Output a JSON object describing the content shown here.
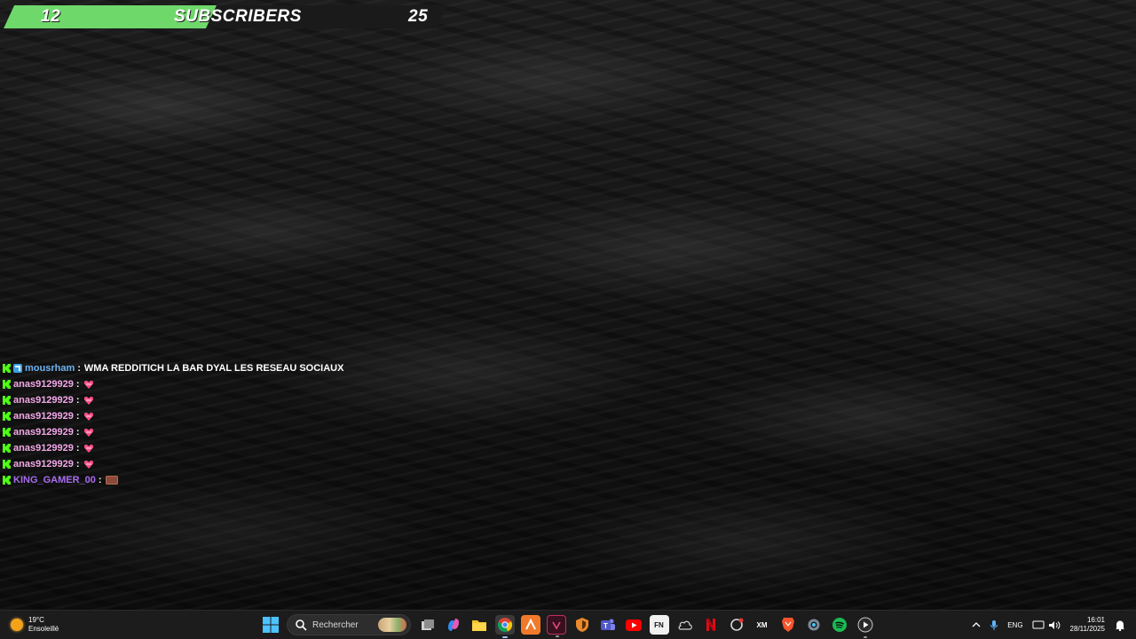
{
  "goal": {
    "current": "12",
    "label": "SUBSCRIBERS",
    "target": "25",
    "progress_fraction": 0.48,
    "fill_color": "#6fd86b"
  },
  "chat": {
    "messages": [
      {
        "user": "mousrham",
        "user_color": "#6fb3f2",
        "badge": "verified-badge-icon",
        "text": "WMA REDDITICH LA BAR DYAL LES RESEAU SOCIAUX",
        "emote": null
      },
      {
        "user": "anas9129929",
        "user_color": "#f4a8e8",
        "badge": null,
        "text": "",
        "emote": "heart-emote-icon"
      },
      {
        "user": "anas9129929",
        "user_color": "#f4a8e8",
        "badge": null,
        "text": "",
        "emote": "heart-emote-icon"
      },
      {
        "user": "anas9129929",
        "user_color": "#f4a8e8",
        "badge": null,
        "text": "",
        "emote": "heart-emote-icon"
      },
      {
        "user": "anas9129929",
        "user_color": "#f4a8e8",
        "badge": null,
        "text": "",
        "emote": "heart-emote-icon"
      },
      {
        "user": "anas9129929",
        "user_color": "#f4a8e8",
        "badge": null,
        "text": "",
        "emote": "heart-emote-icon"
      },
      {
        "user": "anas9129929",
        "user_color": "#f4a8e8",
        "badge": null,
        "text": "",
        "emote": "heart-emote-icon"
      },
      {
        "user": "KING_GAMER_00",
        "user_color": "#a86cf0",
        "badge": null,
        "text": "",
        "emote": "image-emote-icon"
      }
    ],
    "separator": ":",
    "platform_icon": "kick-icon",
    "platform_color": "#53fc18"
  },
  "taskbar": {
    "weather": {
      "temp": "19°C",
      "condition": "Ensoleillé",
      "icon": "sun-icon"
    },
    "search_placeholder": "Rechercher",
    "pinned": [
      {
        "name": "start-button",
        "icon": "windows-icon"
      },
      {
        "name": "search"
      },
      {
        "name": "task-view-button",
        "icon": "task-view-icon"
      },
      {
        "name": "copilot-button",
        "icon": "copilot-icon"
      },
      {
        "name": "file-explorer-button",
        "icon": "folder-icon"
      },
      {
        "name": "chrome-button",
        "icon": "chrome-icon"
      },
      {
        "name": "app-orange-button",
        "icon": "arrow-app-icon"
      },
      {
        "name": "app-check-button",
        "icon": "check-app-icon"
      },
      {
        "name": "app-shield-button",
        "icon": "shield-app-icon"
      },
      {
        "name": "teams-button",
        "icon": "teams-icon"
      },
      {
        "name": "youtube-button",
        "icon": "youtube-icon"
      },
      {
        "name": "app-fn-button",
        "icon": "fn-app-icon",
        "label": "FN"
      },
      {
        "name": "app-cloud-button",
        "icon": "cloud-app-icon"
      },
      {
        "name": "netflix-button",
        "icon": "netflix-icon"
      },
      {
        "name": "app-refresh-button",
        "icon": "refresh-app-icon"
      },
      {
        "name": "app-xm-button",
        "icon": "xm-app-icon",
        "label": "XM"
      },
      {
        "name": "brave-button",
        "icon": "brave-icon"
      },
      {
        "name": "settings-button",
        "icon": "gear-icon"
      },
      {
        "name": "spotify-button",
        "icon": "spotify-icon"
      },
      {
        "name": "media-player-button",
        "icon": "play-icon"
      }
    ],
    "tray": {
      "language": "ENG",
      "time": "16:01",
      "date": "28/11/2025"
    }
  }
}
